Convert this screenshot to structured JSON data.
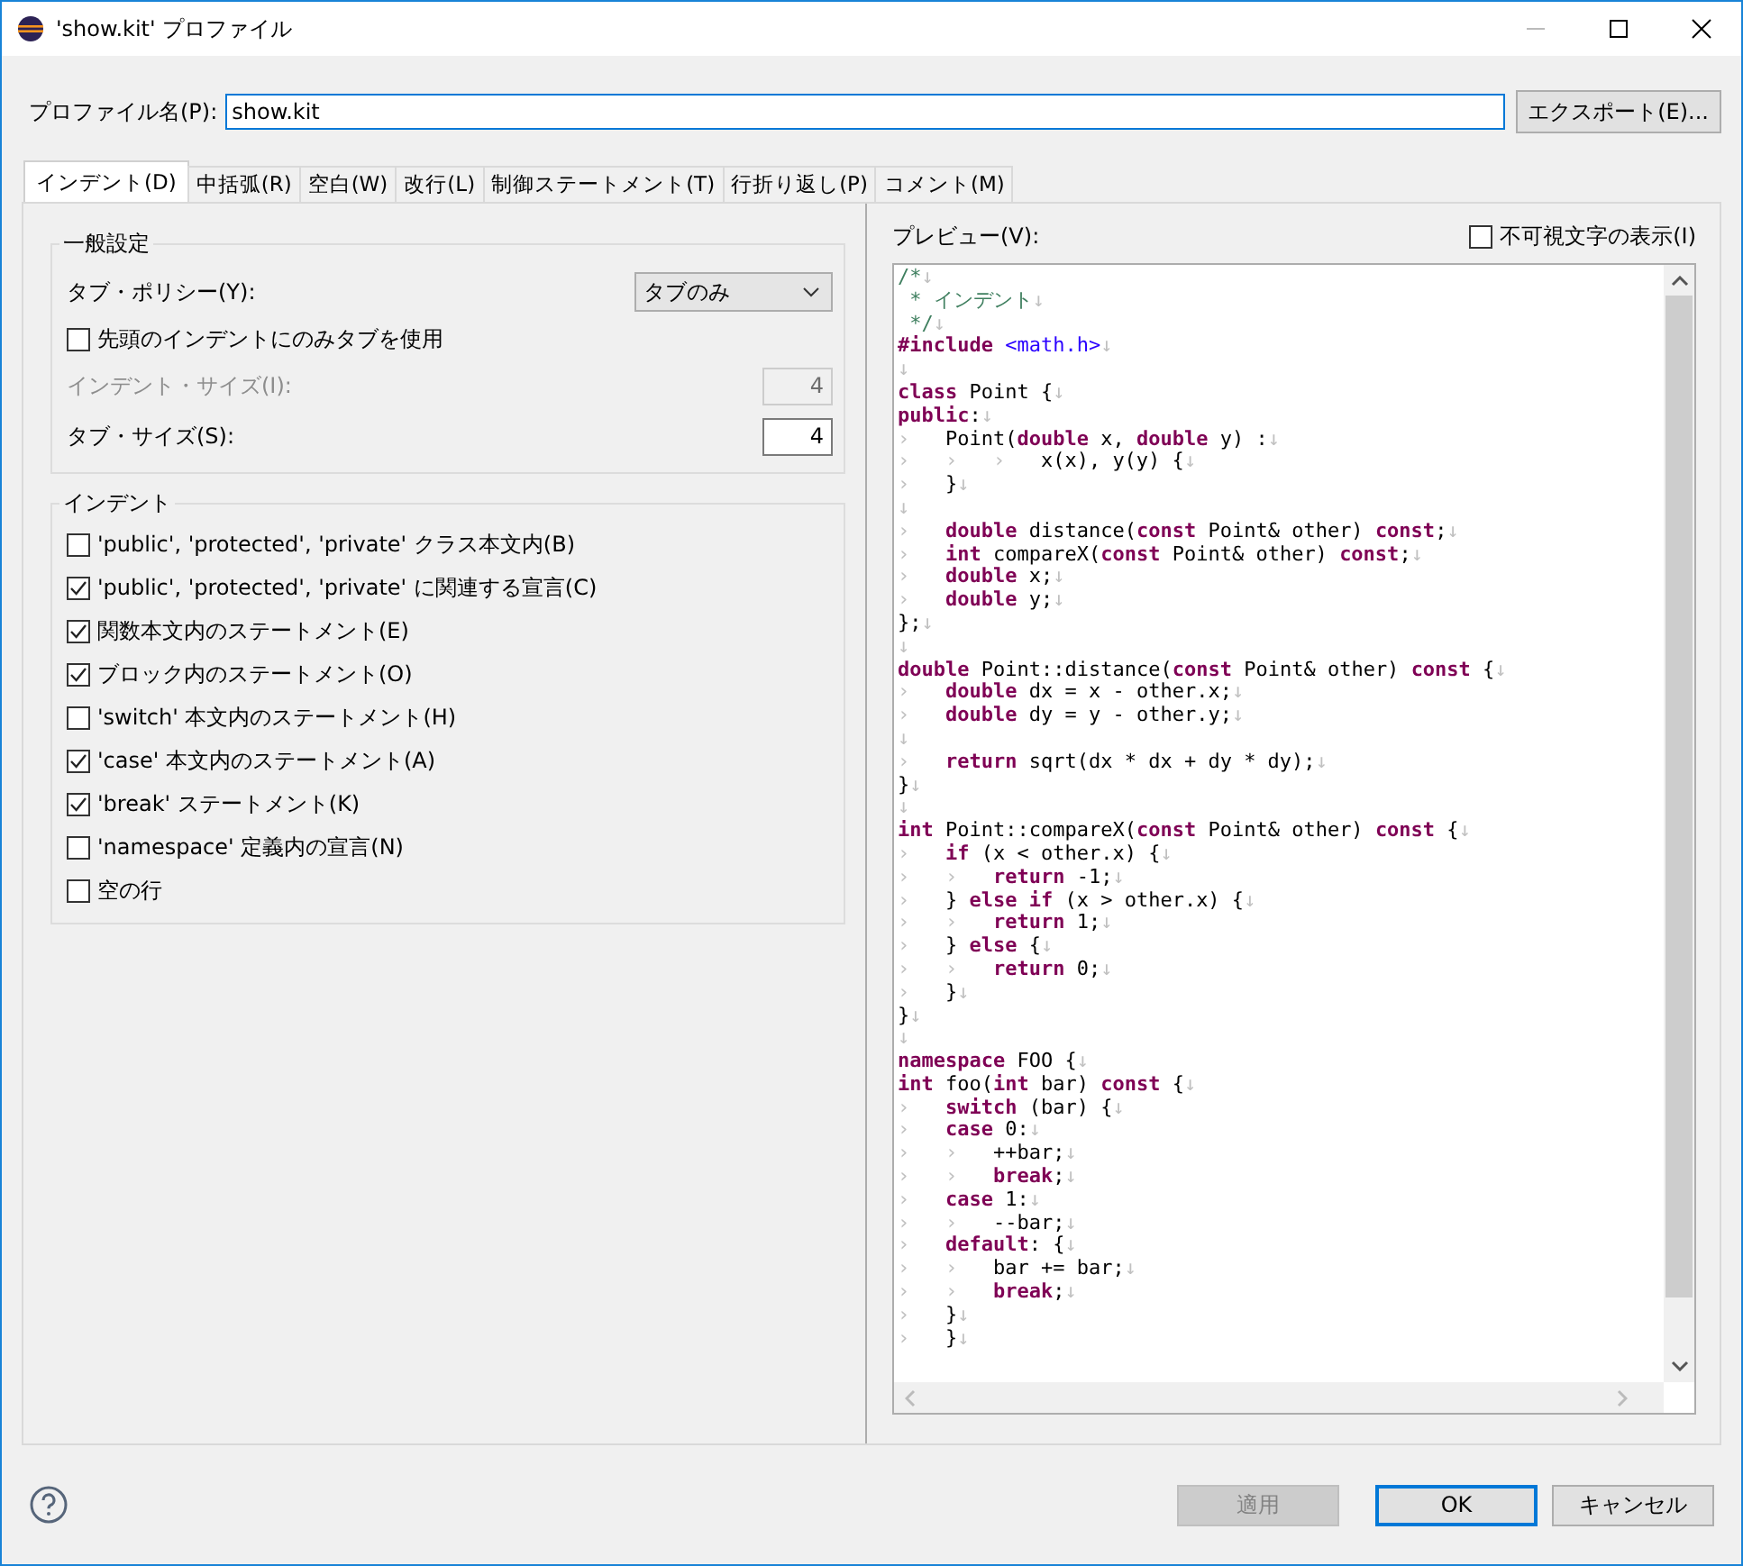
{
  "window": {
    "title": "'show.kit' プロファイル"
  },
  "profile": {
    "label": "プロファイル名(P):",
    "value": "show.kit",
    "export_button": "エクスポート(E)..."
  },
  "tabs": [
    {
      "label": "インデント(D)",
      "selected": true
    },
    {
      "label": "中括弧(R)",
      "selected": false
    },
    {
      "label": "空白(W)",
      "selected": false
    },
    {
      "label": "改行(L)",
      "selected": false
    },
    {
      "label": "制御ステートメント(T)",
      "selected": false
    },
    {
      "label": "行折り返し(P)",
      "selected": false
    },
    {
      "label": "コメント(M)",
      "selected": false
    }
  ],
  "general": {
    "title": "一般設定",
    "tab_policy": {
      "label": "タブ・ポリシー(Y):",
      "value": "タブのみ"
    },
    "leading_tabs": {
      "label": "先頭のインデントにのみタブを使用",
      "checked": false
    },
    "fields": [
      {
        "label": "インデント・サイズ(I):",
        "value": "4",
        "disabled": true
      },
      {
        "label": "タブ・サイズ(S):",
        "value": "4",
        "disabled": false
      }
    ]
  },
  "indent": {
    "title": "インデント",
    "options": [
      {
        "label": "'public', 'protected', 'private' クラス本文内(B)",
        "checked": false
      },
      {
        "label": "'public', 'protected', 'private' に関連する宣言(C)",
        "checked": true
      },
      {
        "label": "関数本文内のステートメント(E)",
        "checked": true
      },
      {
        "label": "ブロック内のステートメント(O)",
        "checked": true
      },
      {
        "label": "'switch' 本文内のステートメント(H)",
        "checked": false
      },
      {
        "label": "'case' 本文内のステートメント(A)",
        "checked": true
      },
      {
        "label": "'break' ステートメント(K)",
        "checked": true
      },
      {
        "label": "'namespace' 定義内の宣言(N)",
        "checked": false
      },
      {
        "label": "空の行",
        "checked": false
      }
    ]
  },
  "preview": {
    "label": "プレビュー(V):",
    "show_invisible": {
      "label": "不可視文字の表示(I)",
      "checked": false
    },
    "lines": [
      [
        {
          "kind": "comment",
          "text": "/*"
        },
        {
          "kind": "eol",
          "text": "↓"
        }
      ],
      [
        {
          "kind": "comment",
          "text": " * インデント"
        },
        {
          "kind": "eol",
          "text": "↓"
        }
      ],
      [
        {
          "kind": "comment",
          "text": " */"
        },
        {
          "kind": "eol",
          "text": "↓"
        }
      ],
      [
        {
          "kind": "keyword",
          "text": "#include"
        },
        {
          "kind": "string",
          "text": " <math.h>"
        },
        {
          "kind": "eol",
          "text": "↓"
        }
      ],
      [
        {
          "kind": "eol",
          "text": "↓"
        }
      ],
      [
        {
          "kind": "keyword",
          "text": "class"
        },
        {
          "kind": "plain",
          "text": " Point {"
        },
        {
          "kind": "eol",
          "text": "↓"
        }
      ],
      [
        {
          "kind": "keyword",
          "text": "public"
        },
        {
          "kind": "plain",
          "text": ":"
        },
        {
          "kind": "eol",
          "text": "↓"
        }
      ],
      [
        {
          "kind": "tab",
          "text": "›"
        },
        {
          "kind": "plain",
          "text": "Point("
        },
        {
          "kind": "keyword",
          "text": "double"
        },
        {
          "kind": "plain",
          "text": " x, "
        },
        {
          "kind": "keyword",
          "text": "double"
        },
        {
          "kind": "plain",
          "text": " y) :"
        },
        {
          "kind": "eol",
          "text": "↓"
        }
      ],
      [
        {
          "kind": "tab",
          "text": "›"
        },
        {
          "kind": "tab",
          "text": "›"
        },
        {
          "kind": "tab",
          "text": "›"
        },
        {
          "kind": "plain",
          "text": "x(x), y(y) {"
        },
        {
          "kind": "eol",
          "text": "↓"
        }
      ],
      [
        {
          "kind": "tab",
          "text": "›"
        },
        {
          "kind": "plain",
          "text": "}"
        },
        {
          "kind": "eol",
          "text": "↓"
        }
      ],
      [
        {
          "kind": "eol",
          "text": "↓"
        }
      ],
      [
        {
          "kind": "tab",
          "text": "›"
        },
        {
          "kind": "keyword",
          "text": "double"
        },
        {
          "kind": "plain",
          "text": " distance("
        },
        {
          "kind": "keyword",
          "text": "const"
        },
        {
          "kind": "plain",
          "text": " Point& other) "
        },
        {
          "kind": "keyword",
          "text": "const"
        },
        {
          "kind": "plain",
          "text": ";"
        },
        {
          "kind": "eol",
          "text": "↓"
        }
      ],
      [
        {
          "kind": "tab",
          "text": "›"
        },
        {
          "kind": "keyword",
          "text": "int"
        },
        {
          "kind": "plain",
          "text": " compareX("
        },
        {
          "kind": "keyword",
          "text": "const"
        },
        {
          "kind": "plain",
          "text": " Point& other) "
        },
        {
          "kind": "keyword",
          "text": "const"
        },
        {
          "kind": "plain",
          "text": ";"
        },
        {
          "kind": "eol",
          "text": "↓"
        }
      ],
      [
        {
          "kind": "tab",
          "text": "›"
        },
        {
          "kind": "keyword",
          "text": "double"
        },
        {
          "kind": "plain",
          "text": " x;"
        },
        {
          "kind": "eol",
          "text": "↓"
        }
      ],
      [
        {
          "kind": "tab",
          "text": "›"
        },
        {
          "kind": "keyword",
          "text": "double"
        },
        {
          "kind": "plain",
          "text": " y;"
        },
        {
          "kind": "eol",
          "text": "↓"
        }
      ],
      [
        {
          "kind": "plain",
          "text": "};"
        },
        {
          "kind": "eol",
          "text": "↓"
        }
      ],
      [
        {
          "kind": "eol",
          "text": "↓"
        }
      ],
      [
        {
          "kind": "keyword",
          "text": "double"
        },
        {
          "kind": "plain",
          "text": " Point::distance("
        },
        {
          "kind": "keyword",
          "text": "const"
        },
        {
          "kind": "plain",
          "text": " Point& other) "
        },
        {
          "kind": "keyword",
          "text": "const"
        },
        {
          "kind": "plain",
          "text": " {"
        },
        {
          "kind": "eol",
          "text": "↓"
        }
      ],
      [
        {
          "kind": "tab",
          "text": "›"
        },
        {
          "kind": "keyword",
          "text": "double"
        },
        {
          "kind": "plain",
          "text": " dx = x - other.x;"
        },
        {
          "kind": "eol",
          "text": "↓"
        }
      ],
      [
        {
          "kind": "tab",
          "text": "›"
        },
        {
          "kind": "keyword",
          "text": "double"
        },
        {
          "kind": "plain",
          "text": " dy = y - other.y;"
        },
        {
          "kind": "eol",
          "text": "↓"
        }
      ],
      [
        {
          "kind": "eol",
          "text": "↓"
        }
      ],
      [
        {
          "kind": "tab",
          "text": "›"
        },
        {
          "kind": "keyword",
          "text": "return"
        },
        {
          "kind": "plain",
          "text": " sqrt(dx * dx + dy * dy);"
        },
        {
          "kind": "eol",
          "text": "↓"
        }
      ],
      [
        {
          "kind": "plain",
          "text": "}"
        },
        {
          "kind": "eol",
          "text": "↓"
        }
      ],
      [
        {
          "kind": "eol",
          "text": "↓"
        }
      ],
      [
        {
          "kind": "keyword",
          "text": "int"
        },
        {
          "kind": "plain",
          "text": " Point::compareX("
        },
        {
          "kind": "keyword",
          "text": "const"
        },
        {
          "kind": "plain",
          "text": " Point& other) "
        },
        {
          "kind": "keyword",
          "text": "const"
        },
        {
          "kind": "plain",
          "text": " {"
        },
        {
          "kind": "eol",
          "text": "↓"
        }
      ],
      [
        {
          "kind": "tab",
          "text": "›"
        },
        {
          "kind": "keyword",
          "text": "if"
        },
        {
          "kind": "plain",
          "text": " (x < other.x) {"
        },
        {
          "kind": "eol",
          "text": "↓"
        }
      ],
      [
        {
          "kind": "tab",
          "text": "›"
        },
        {
          "kind": "tab",
          "text": "›"
        },
        {
          "kind": "keyword",
          "text": "return"
        },
        {
          "kind": "plain",
          "text": " -1;"
        },
        {
          "kind": "eol",
          "text": "↓"
        }
      ],
      [
        {
          "kind": "tab",
          "text": "›"
        },
        {
          "kind": "plain",
          "text": "} "
        },
        {
          "kind": "keyword",
          "text": "else if"
        },
        {
          "kind": "plain",
          "text": " (x > other.x) {"
        },
        {
          "kind": "eol",
          "text": "↓"
        }
      ],
      [
        {
          "kind": "tab",
          "text": "›"
        },
        {
          "kind": "tab",
          "text": "›"
        },
        {
          "kind": "keyword",
          "text": "return"
        },
        {
          "kind": "plain",
          "text": " 1;"
        },
        {
          "kind": "eol",
          "text": "↓"
        }
      ],
      [
        {
          "kind": "tab",
          "text": "›"
        },
        {
          "kind": "plain",
          "text": "} "
        },
        {
          "kind": "keyword",
          "text": "else"
        },
        {
          "kind": "plain",
          "text": " {"
        },
        {
          "kind": "eol",
          "text": "↓"
        }
      ],
      [
        {
          "kind": "tab",
          "text": "›"
        },
        {
          "kind": "tab",
          "text": "›"
        },
        {
          "kind": "keyword",
          "text": "return"
        },
        {
          "kind": "plain",
          "text": " 0;"
        },
        {
          "kind": "eol",
          "text": "↓"
        }
      ],
      [
        {
          "kind": "tab",
          "text": "›"
        },
        {
          "kind": "plain",
          "text": "}"
        },
        {
          "kind": "eol",
          "text": "↓"
        }
      ],
      [
        {
          "kind": "plain",
          "text": "}"
        },
        {
          "kind": "eol",
          "text": "↓"
        }
      ],
      [
        {
          "kind": "eol",
          "text": "↓"
        }
      ],
      [
        {
          "kind": "keyword",
          "text": "namespace"
        },
        {
          "kind": "plain",
          "text": " FOO {"
        },
        {
          "kind": "eol",
          "text": "↓"
        }
      ],
      [
        {
          "kind": "keyword",
          "text": "int"
        },
        {
          "kind": "plain",
          "text": " foo("
        },
        {
          "kind": "keyword",
          "text": "int"
        },
        {
          "kind": "plain",
          "text": " bar) "
        },
        {
          "kind": "keyword",
          "text": "const"
        },
        {
          "kind": "plain",
          "text": " {"
        },
        {
          "kind": "eol",
          "text": "↓"
        }
      ],
      [
        {
          "kind": "tab",
          "text": "›"
        },
        {
          "kind": "keyword",
          "text": "switch"
        },
        {
          "kind": "plain",
          "text": " (bar) {"
        },
        {
          "kind": "eol",
          "text": "↓"
        }
      ],
      [
        {
          "kind": "tab",
          "text": "›"
        },
        {
          "kind": "keyword",
          "text": "case"
        },
        {
          "kind": "plain",
          "text": " 0:"
        },
        {
          "kind": "eol",
          "text": "↓"
        }
      ],
      [
        {
          "kind": "tab",
          "text": "›"
        },
        {
          "kind": "tab",
          "text": "›"
        },
        {
          "kind": "plain",
          "text": "++bar;"
        },
        {
          "kind": "eol",
          "text": "↓"
        }
      ],
      [
        {
          "kind": "tab",
          "text": "›"
        },
        {
          "kind": "tab",
          "text": "›"
        },
        {
          "kind": "keyword",
          "text": "break"
        },
        {
          "kind": "plain",
          "text": ";"
        },
        {
          "kind": "eol",
          "text": "↓"
        }
      ],
      [
        {
          "kind": "tab",
          "text": "›"
        },
        {
          "kind": "keyword",
          "text": "case"
        },
        {
          "kind": "plain",
          "text": " 1:"
        },
        {
          "kind": "eol",
          "text": "↓"
        }
      ],
      [
        {
          "kind": "tab",
          "text": "›"
        },
        {
          "kind": "tab",
          "text": "›"
        },
        {
          "kind": "plain",
          "text": "--bar;"
        },
        {
          "kind": "eol",
          "text": "↓"
        }
      ],
      [
        {
          "kind": "tab",
          "text": "›"
        },
        {
          "kind": "keyword",
          "text": "default"
        },
        {
          "kind": "plain",
          "text": ": {"
        },
        {
          "kind": "eol",
          "text": "↓"
        }
      ],
      [
        {
          "kind": "tab",
          "text": "›"
        },
        {
          "kind": "tab",
          "text": "›"
        },
        {
          "kind": "plain",
          "text": "bar += bar;"
        },
        {
          "kind": "eol",
          "text": "↓"
        }
      ],
      [
        {
          "kind": "tab",
          "text": "›"
        },
        {
          "kind": "tab",
          "text": "›"
        },
        {
          "kind": "keyword",
          "text": "break"
        },
        {
          "kind": "plain",
          "text": ";"
        },
        {
          "kind": "eol",
          "text": "↓"
        }
      ],
      [
        {
          "kind": "tab",
          "text": "›"
        },
        {
          "kind": "plain",
          "text": "}"
        },
        {
          "kind": "eol",
          "text": "↓"
        }
      ],
      [
        {
          "kind": "tab",
          "text": "›"
        },
        {
          "kind": "plain",
          "text": "}"
        },
        {
          "kind": "eol",
          "text": "↓"
        }
      ]
    ]
  },
  "buttons": [
    {
      "label": "適用",
      "disabled": true,
      "default": false
    },
    {
      "label": "OK",
      "disabled": false,
      "default": true
    },
    {
      "label": "キャンセル",
      "disabled": false,
      "default": false
    }
  ]
}
